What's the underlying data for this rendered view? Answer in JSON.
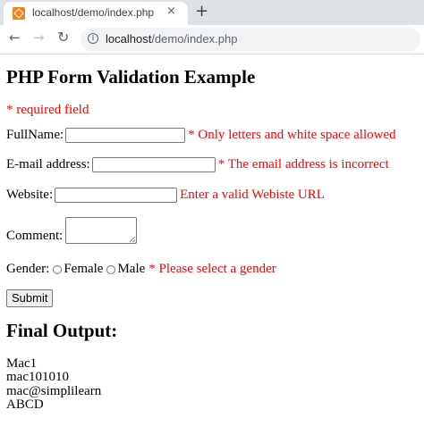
{
  "browser": {
    "tab_title": "localhost/demo/index.php",
    "tab_close": "×",
    "new_tab": "+",
    "url_host": "localhost",
    "url_path": "/demo/index.php",
    "icons": [
      "favicon-icon",
      "close-icon",
      "plus-icon",
      "back-arrow-icon",
      "forward-arrow-icon",
      "reload-icon",
      "info-icon"
    ]
  },
  "page": {
    "title": "PHP Form Validation Example",
    "required_note": "* required field",
    "fullname": {
      "label": "FullName:",
      "value": "",
      "error": "* Only letters and white space allowed"
    },
    "email": {
      "label": "E-mail address:",
      "value": "",
      "error": "* The email address is incorrect"
    },
    "website": {
      "label": "Website:",
      "value": "",
      "error": "Enter a valid Webiste URL"
    },
    "comment": {
      "label": "Comment:",
      "value": ""
    },
    "gender": {
      "label": "Gender:",
      "options": [
        "Female",
        "Male"
      ],
      "error": "* Please select a gender"
    },
    "submit_label": "Submit",
    "output_title": "Final Output:",
    "output_lines": [
      "Mac1",
      "mac101010",
      "mac@simplilearn",
      "ABCD"
    ]
  },
  "colors": {
    "error": "#ff0000",
    "tabstrip": "#dee1e6",
    "omnibox": "#f1f3f4"
  }
}
